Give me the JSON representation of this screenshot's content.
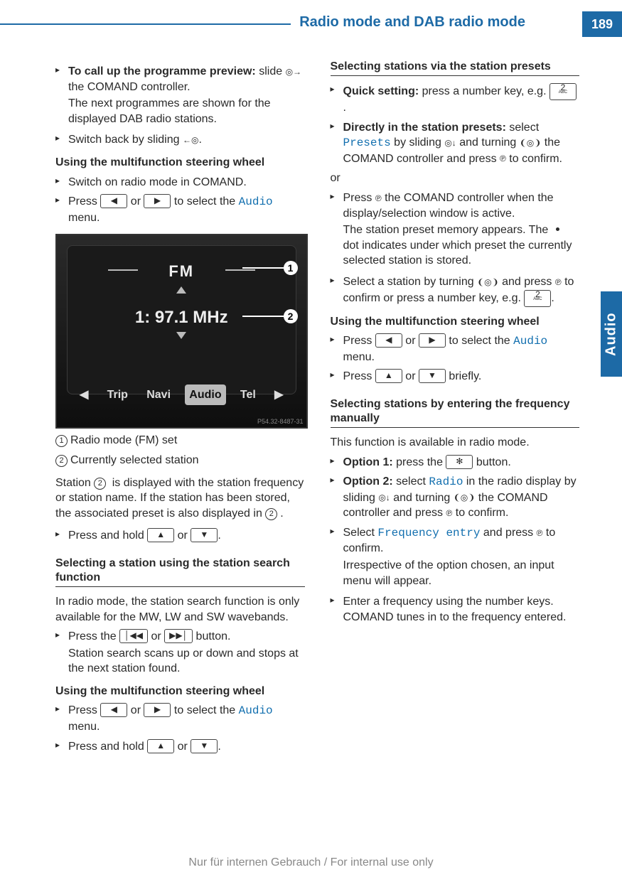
{
  "header": {
    "title": "Radio mode and DAB radio mode",
    "page_number": "189",
    "side_tab": "Audio"
  },
  "footer": "Nur für internen Gebrauch / For internal use only",
  "display_image": {
    "fm": "FM",
    "preset_freq": "1:  97.1 MHz",
    "nav_trip": "Trip",
    "nav_navi": "Navi",
    "nav_audio": "Audio",
    "nav_tel": "Tel",
    "callout1": "1",
    "callout2": "2",
    "imgcode": "P54.32-8487-31"
  },
  "captions": {
    "c1": "Radio mode (FM) set",
    "c2": "Currently selected station"
  },
  "left": {
    "preview_bold": "To call up the programme preview: ",
    "preview_text": "slide ",
    "preview_text2": " the COMAND controller.",
    "preview_sub": "The next programmes are shown for the displayed DAB radio stations.",
    "switch_back": "Switch back by sliding ",
    "h_wheel": "Using the multifunction steering wheel",
    "switch_radio": "Switch on radio mode in COMAND.",
    "press1a": "Press ",
    "press1b": " or ",
    "press1c": " to select the ",
    "audio": "Audio",
    "press1d": " menu.",
    "station_para1": "Station ",
    "station_para2": " is displayed with the station frequency or station name. If the station has been stored, the associated preset is also displayed in ",
    "station_para3": ".",
    "press_hold_a": "Press and hold ",
    "press_hold_b": " or ",
    "press_hold_c": ".",
    "h_search": "Selecting a station using the station search function",
    "search_para": "In radio mode, the station search function is only available for the MW, LW and SW wavebands.",
    "press_se_a": "Press the ",
    "press_se_b": " or ",
    "press_se_c": " button.",
    "search_sub": "Station search scans up or down and stops at the next station found.",
    "h_wheel2": "Using the multifunction steering wheel",
    "press2a": "Press ",
    "press2b": " or ",
    "press2c": " to select the ",
    "press2d": " menu.",
    "press_hold2_a": "Press and hold ",
    "press_hold2_b": " or ",
    "press_hold2_c": "."
  },
  "right": {
    "h_presets": "Selecting stations via the station presets",
    "quick_bold": "Quick setting: ",
    "quick_text": "press a number key, e.g. ",
    "quick_text2": ".",
    "direct_bold": "Directly in the station presets: ",
    "direct_text1": "select ",
    "presets": "Presets",
    "direct_text2": " by sliding ",
    "direct_text3": " and turning ",
    "direct_text4": " the COMAND controller and press ",
    "direct_text5": " to confirm.",
    "or": "or",
    "press_ctrl_a": "Press ",
    "press_ctrl_b": " the COMAND controller when the display/selection window is active.",
    "press_ctrl_sub1": "The station preset memory appears. The ",
    "press_ctrl_sub2": " dot indicates under which preset the currently selected station is stored.",
    "select_st_a": "Select a station by turning ",
    "select_st_b": " and press ",
    "select_st_c": " to confirm or press a number key, e.g. ",
    "select_st_d": ".",
    "h_wheel3": "Using the multifunction steering wheel",
    "press3a": "Press ",
    "press3b": " or ",
    "press3c": " to select the ",
    "press3d": " menu.",
    "press4a": "Press ",
    "press4b": " or ",
    "press4c": " briefly.",
    "h_freq": "Selecting stations by entering the frequency manually",
    "freq_avail": "This function is available in radio mode.",
    "opt1_bold": "Option 1: ",
    "opt1_text": "press the ",
    "opt1_text2": " button.",
    "opt2_bold": "Option 2: ",
    "opt2_text1": "select ",
    "radio": "Radio",
    "opt2_text2": " in the radio display by sliding ",
    "opt2_text3": " and turning ",
    "opt2_text4": " the COMAND controller and press ",
    "opt2_text5": " to confirm.",
    "freq_entry_a": "Select ",
    "freq_entry_menu": "Frequency entry",
    "freq_entry_b": " and press ",
    "freq_entry_c": " to confirm.",
    "freq_entry_sub": "Irrespective of the option chosen, an input menu will appear.",
    "enter_freq": "Enter a frequency using the number keys. COMAND tunes in to the frequency entered."
  },
  "keys": {
    "left_arrow": "◀",
    "right_arrow": "▶",
    "up_arrow": "▲",
    "down_arrow": "▼",
    "seek_back": "│◀◀",
    "seek_fwd": "▶▶│",
    "two": "2",
    "two_sub": "ABC",
    "star": "✻"
  },
  "symbols": {
    "circle_right": "◎→",
    "left_circle": "←◎",
    "circle_down": "◎↓",
    "turn": "❨◎❩",
    "press": "℗"
  }
}
